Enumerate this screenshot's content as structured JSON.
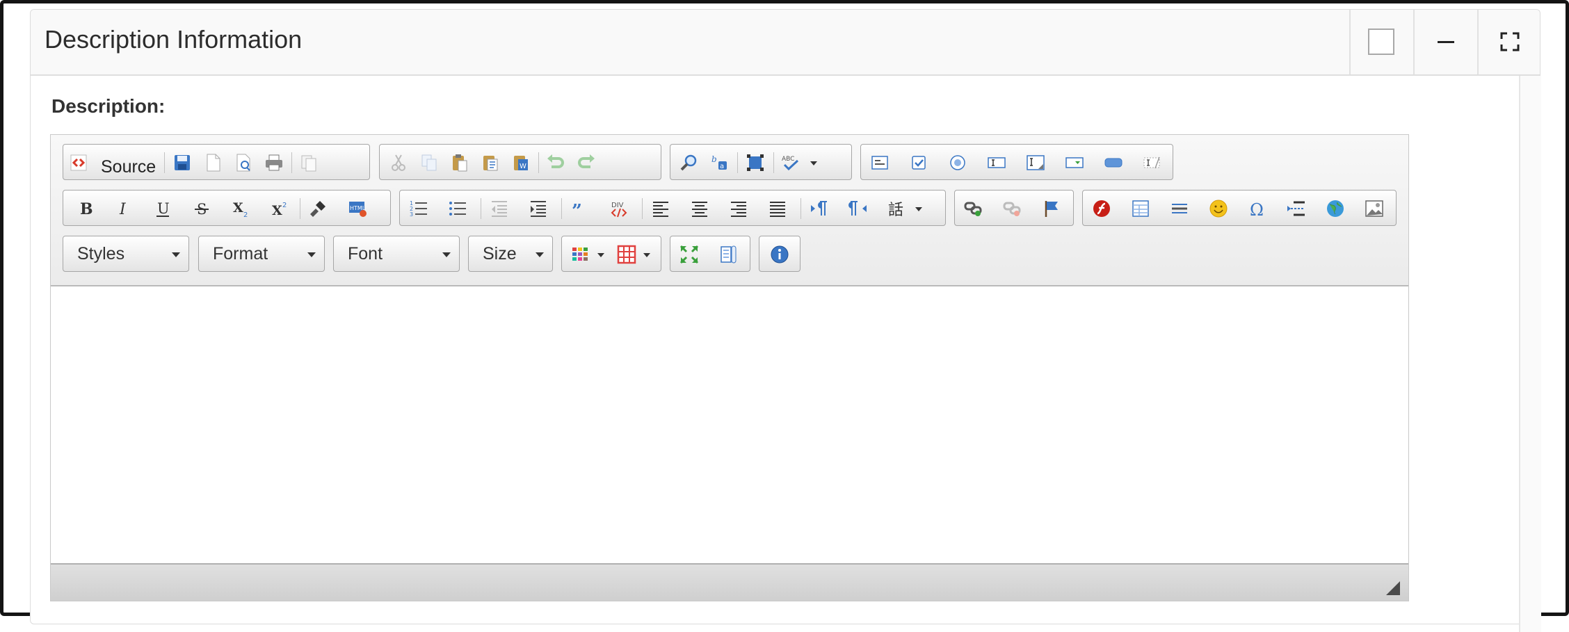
{
  "panel": {
    "title": "Description Information",
    "controls": [
      "checkbox",
      "minimize-icon",
      "fullscreen-icon"
    ]
  },
  "field": {
    "label": "Description:"
  },
  "editor": {
    "source_label": "Source",
    "combos": {
      "styles": "Styles",
      "format": "Format",
      "font": "Font",
      "size": "Size"
    },
    "content": ""
  },
  "colors": {
    "accent_blue": "#3a76c4",
    "source_red": "#d83a2a",
    "flash_red": "#c71f16",
    "smiley_yellow": "#f3c21b",
    "table_red": "#e0413f",
    "resize_green": "#3aa03c"
  }
}
